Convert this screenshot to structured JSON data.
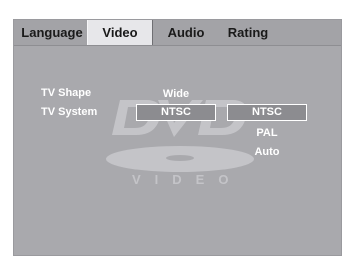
{
  "tabs": [
    {
      "label": "Language",
      "active": false
    },
    {
      "label": "Video",
      "active": true
    },
    {
      "label": "Audio",
      "active": false
    },
    {
      "label": "Rating",
      "active": false
    }
  ],
  "settings": {
    "tv_shape": {
      "label": "TV Shape",
      "value": "Wide"
    },
    "tv_system": {
      "label": "TV System",
      "value": "NTSC"
    }
  },
  "tv_system_options": {
    "selected": "NTSC",
    "items": [
      "PAL",
      "Auto"
    ]
  },
  "logo": {
    "word": "DVD",
    "sub": "VIDEO",
    "color": "#c4c4c8"
  },
  "colors": {
    "panel": "#a9a9ad",
    "active_tab": "#e7e7ea",
    "text": "#ffffff"
  }
}
